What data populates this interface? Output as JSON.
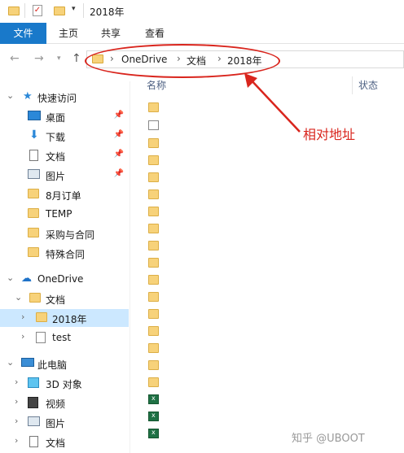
{
  "window": {
    "title": "2018年"
  },
  "ribbon": {
    "tabs": [
      "文件",
      "主页",
      "共享",
      "查看"
    ]
  },
  "address": {
    "crumbs": [
      "OneDrive",
      "文档",
      "2018年"
    ]
  },
  "annotation": {
    "label": "相对地址"
  },
  "columns": {
    "name": "名称",
    "status": "状态"
  },
  "sidebar": {
    "quick_access": "快速访问",
    "quick_items": [
      "桌面",
      "下载",
      "文档",
      "图片",
      "8月订单",
      "TEMP",
      "采购与合同",
      "特殊合同"
    ],
    "onedrive": "OneDrive",
    "onedrive_items": [
      "文档",
      "2018年",
      "test"
    ],
    "this_pc": "此电脑",
    "pc_items": [
      "3D 对象",
      "视频",
      "图片",
      "文档"
    ]
  },
  "watermark": "知乎 @UBOOT",
  "accent_color": "#1979ca",
  "annotation_color": "#d9251d"
}
